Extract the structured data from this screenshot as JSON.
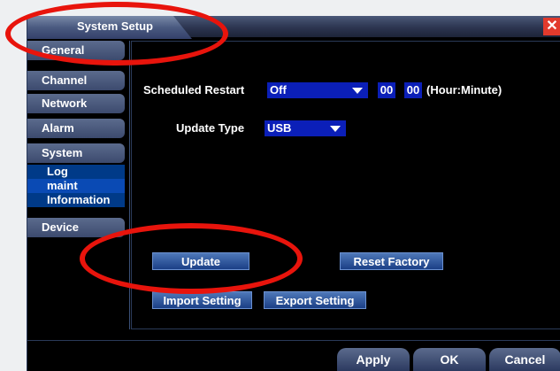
{
  "window": {
    "title": "System Setup",
    "close_icon": "close-icon"
  },
  "sidebar": {
    "items": [
      {
        "label": "General"
      },
      {
        "label": "Channel"
      },
      {
        "label": "Network"
      },
      {
        "label": "Alarm"
      },
      {
        "label": "System"
      },
      {
        "label": "Log"
      },
      {
        "label": "maint"
      },
      {
        "label": "Information"
      },
      {
        "label": "Device"
      }
    ]
  },
  "form": {
    "scheduled_restart_label": "Scheduled Restart",
    "scheduled_restart_value": "Off",
    "hour_value": "00",
    "minute_value": "00",
    "time_unit_label": "(Hour:Minute)",
    "update_type_label": "Update Type",
    "update_type_value": "USB"
  },
  "buttons": {
    "update": "Update",
    "reset_factory": "Reset Factory",
    "import_setting": "Import Setting",
    "export_setting": "Export Setting"
  },
  "footer": {
    "apply": "Apply",
    "ok": "OK",
    "cancel": "Cancel"
  },
  "colors": {
    "annotation": "#e8140c",
    "select_bg": "#0b1fb8",
    "close": "#e23a2c"
  }
}
